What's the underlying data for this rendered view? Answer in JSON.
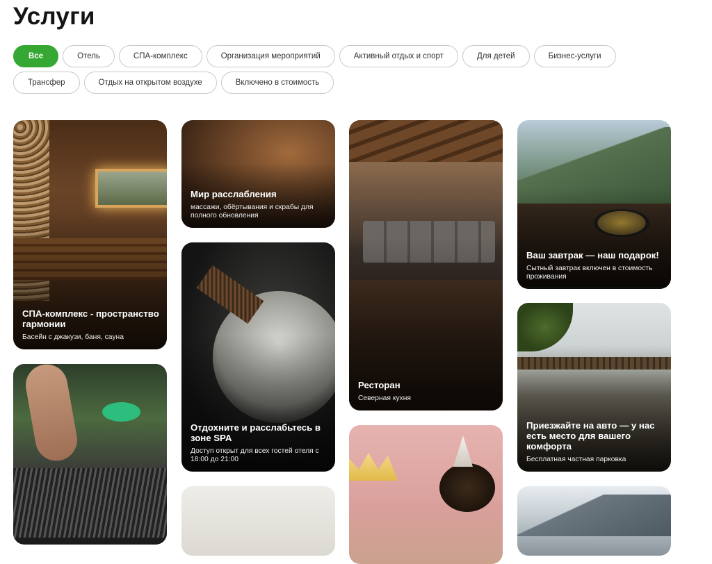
{
  "page": {
    "title": "Услуги"
  },
  "filters": {
    "row1": [
      "Все",
      "Отель",
      "СПА-комплекс",
      "Организация мероприятий",
      "Активный отдых и спорт",
      "Для детей",
      "Бизнес-услуги"
    ],
    "row2": [
      "Трансфер",
      "Отдых на открытом воздухе",
      "Включено в стоимость"
    ],
    "active": "Все"
  },
  "colors": {
    "accent": "#35a833"
  },
  "cards": {
    "spa_complex": {
      "title": "СПА-комплекс - пространство гармонии",
      "desc": "Басейн с джакузи, баня, сауна"
    },
    "relax_world": {
      "title": "Мир расслабления",
      "desc": "массажи, обёртывания и скрабы для полного обновления"
    },
    "restaurant": {
      "title": "Ресторан",
      "desc": "Северная кухня"
    },
    "breakfast": {
      "title": "Ваш завтрак — наш подарок!",
      "desc": "Сытный завтрак включен в стоимость проживания"
    },
    "spa_rest": {
      "title": "Отдохните и расслабьтесь в зоне SPA",
      "desc": "Доступ открыт для всех гостей отеля с 18:00 до 21:00"
    },
    "parking": {
      "title": "Приезжайте на авто — у нас есть место для вашего комфорта",
      "desc": "Бесплатная частная парковка"
    },
    "bbq": {
      "title": "",
      "desc": ""
    },
    "kids": {
      "title": "",
      "desc": ""
    },
    "col2_bottom": {
      "title": "",
      "desc": ""
    },
    "col4_bottom": {
      "title": "",
      "desc": ""
    }
  }
}
